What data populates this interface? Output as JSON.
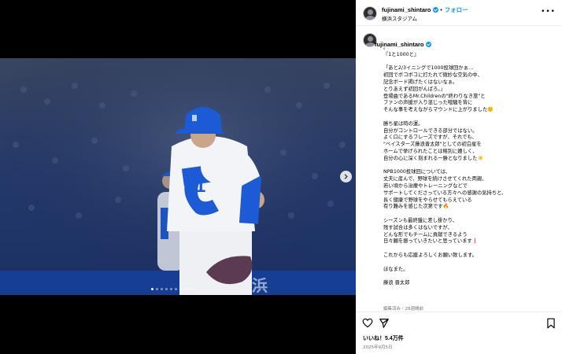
{
  "post": {
    "username": "fujinami_shintaro",
    "follow_label": "フォロー",
    "location": "横浜スタジアム",
    "caption": "。\n『1と1000と』\n\n「あと2/3イニングで1000投球回かぁ…\n初回でボコボコに打たれて微妙な空気の中、\n記念ボード掲げたくはないなぁ。\nとりあえず初回がんばろ。」\n登場曲であるMr.Childrenの\"終わりなき旅\"と\nファンの声援が入り混じった喧騒を背に\nそんな事を考えながらマウンドに上がりました🙂\n\n勝ち星は時の運。\n自分がコントロールできる部分ではない。\nよく口にするフレーズですが、それでも、\n\"ベイスターズ藤浪晋太郎\"としての初白星を\nホームで挙げられたことは格別に嬉しく、\n自分の心に深く刻まれる一勝となりました☀️\n\nNPB1000投球回については、\n丈夫に産んで、野球を続けさせてくれた両親、\n若い頃から治療やトレーニングなどで\nサポートしてくださっている方々への感謝の気持ちと、\n長く健康で野球をやらせてもらえている\n有り難みを感じた次第です🔥\n\nシーズンも最終盤に差し掛かり、\n残す試合は多くはないですが、\nどんな形でもチームに貢献できるよう\n日々願を振っていきたいと思っています❗\n\nこれからも応援よろしくお願い致します。\n\nほなまた。\n\n藤浪 晋太郎",
    "edited_note": "編集済み・28週間前",
    "likes": "いいね！5.4万件",
    "date": "2025年9月5日"
  },
  "media": {
    "carousel_count": 9,
    "carousel_active": 0,
    "photo_alt": "pitcher celebrating on the mound",
    "icons": {
      "next": "chevron-right-icon"
    }
  },
  "actions": {
    "icons": [
      "heart-icon",
      "share-icon",
      "bookmark-icon"
    ]
  },
  "colors": {
    "accent": "#0095f6",
    "jersey_blue": "#1d5bd6",
    "muted": "#737373"
  }
}
